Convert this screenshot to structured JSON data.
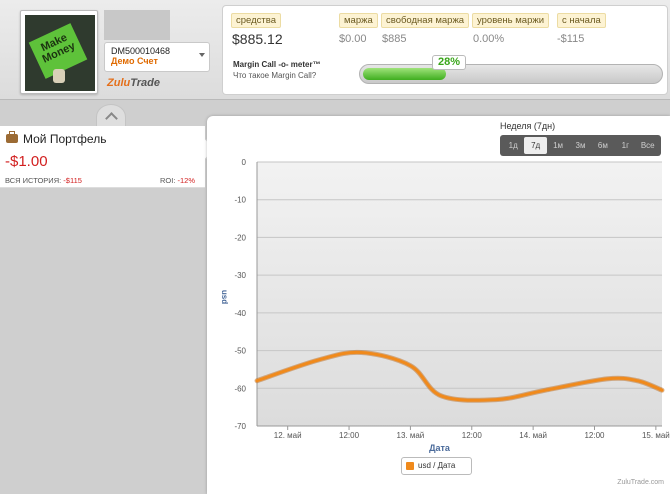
{
  "account": {
    "id": "DM500010468",
    "type": "Демо Счет",
    "brand_a": "Zulu",
    "brand_b": "Trade",
    "avatar_text": "Make Money"
  },
  "stats": [
    {
      "label": "средства",
      "value": "$885.12"
    },
    {
      "label": "маржа",
      "value": "$0.00"
    },
    {
      "label": "свободная маржа",
      "value": "$885"
    },
    {
      "label": "уровень маржи",
      "value": "0.00%"
    },
    {
      "label": "с начала",
      "value": "-$115"
    }
  ],
  "margin_call": {
    "title": "Margin Call -o- meter™",
    "subtitle": "Что такое Margin Call?",
    "percent_label": "28%",
    "fraction": 0.28
  },
  "portfolio": {
    "title": "Мой Портфель",
    "value": "-$1.00",
    "history_label": "ВСЯ ИСТОРИЯ: ",
    "history_value": "-$115",
    "roi_label": "ROI: ",
    "roi_value": "-12%"
  },
  "periods": {
    "title": "Неделя (7дн)",
    "buttons": [
      "1д",
      "7д",
      "1м",
      "3м",
      "6м",
      "1г",
      "Все"
    ],
    "active": "7д"
  },
  "legend": "usd / Дата",
  "watermark": "ZuluTrade.com",
  "colors": {
    "series": "#f08a1c",
    "negative": "#d21f1f",
    "meter": "#3fae1f"
  },
  "chart_data": {
    "type": "line",
    "xlabel": "Дата",
    "ylabel": "usd",
    "ylim": [
      -70,
      0
    ],
    "yticks": [
      0,
      -10,
      -20,
      -30,
      -40,
      -50,
      -60,
      -70
    ],
    "xticks": [
      "12. май",
      "12:00",
      "13. май",
      "12:00",
      "14. май",
      "12:00",
      "15. май"
    ],
    "x_range": [
      -0.25,
      3.05
    ],
    "series": [
      {
        "name": "usd / Дата",
        "x": [
          -0.25,
          0.25,
          0.6,
          1.0,
          1.25,
          1.7,
          2.1,
          2.6,
          2.85,
          3.05
        ],
        "y": [
          -58,
          -52.5,
          -50.5,
          -54,
          -62,
          -63,
          -60.5,
          -57.5,
          -58,
          -60.5
        ]
      }
    ]
  }
}
